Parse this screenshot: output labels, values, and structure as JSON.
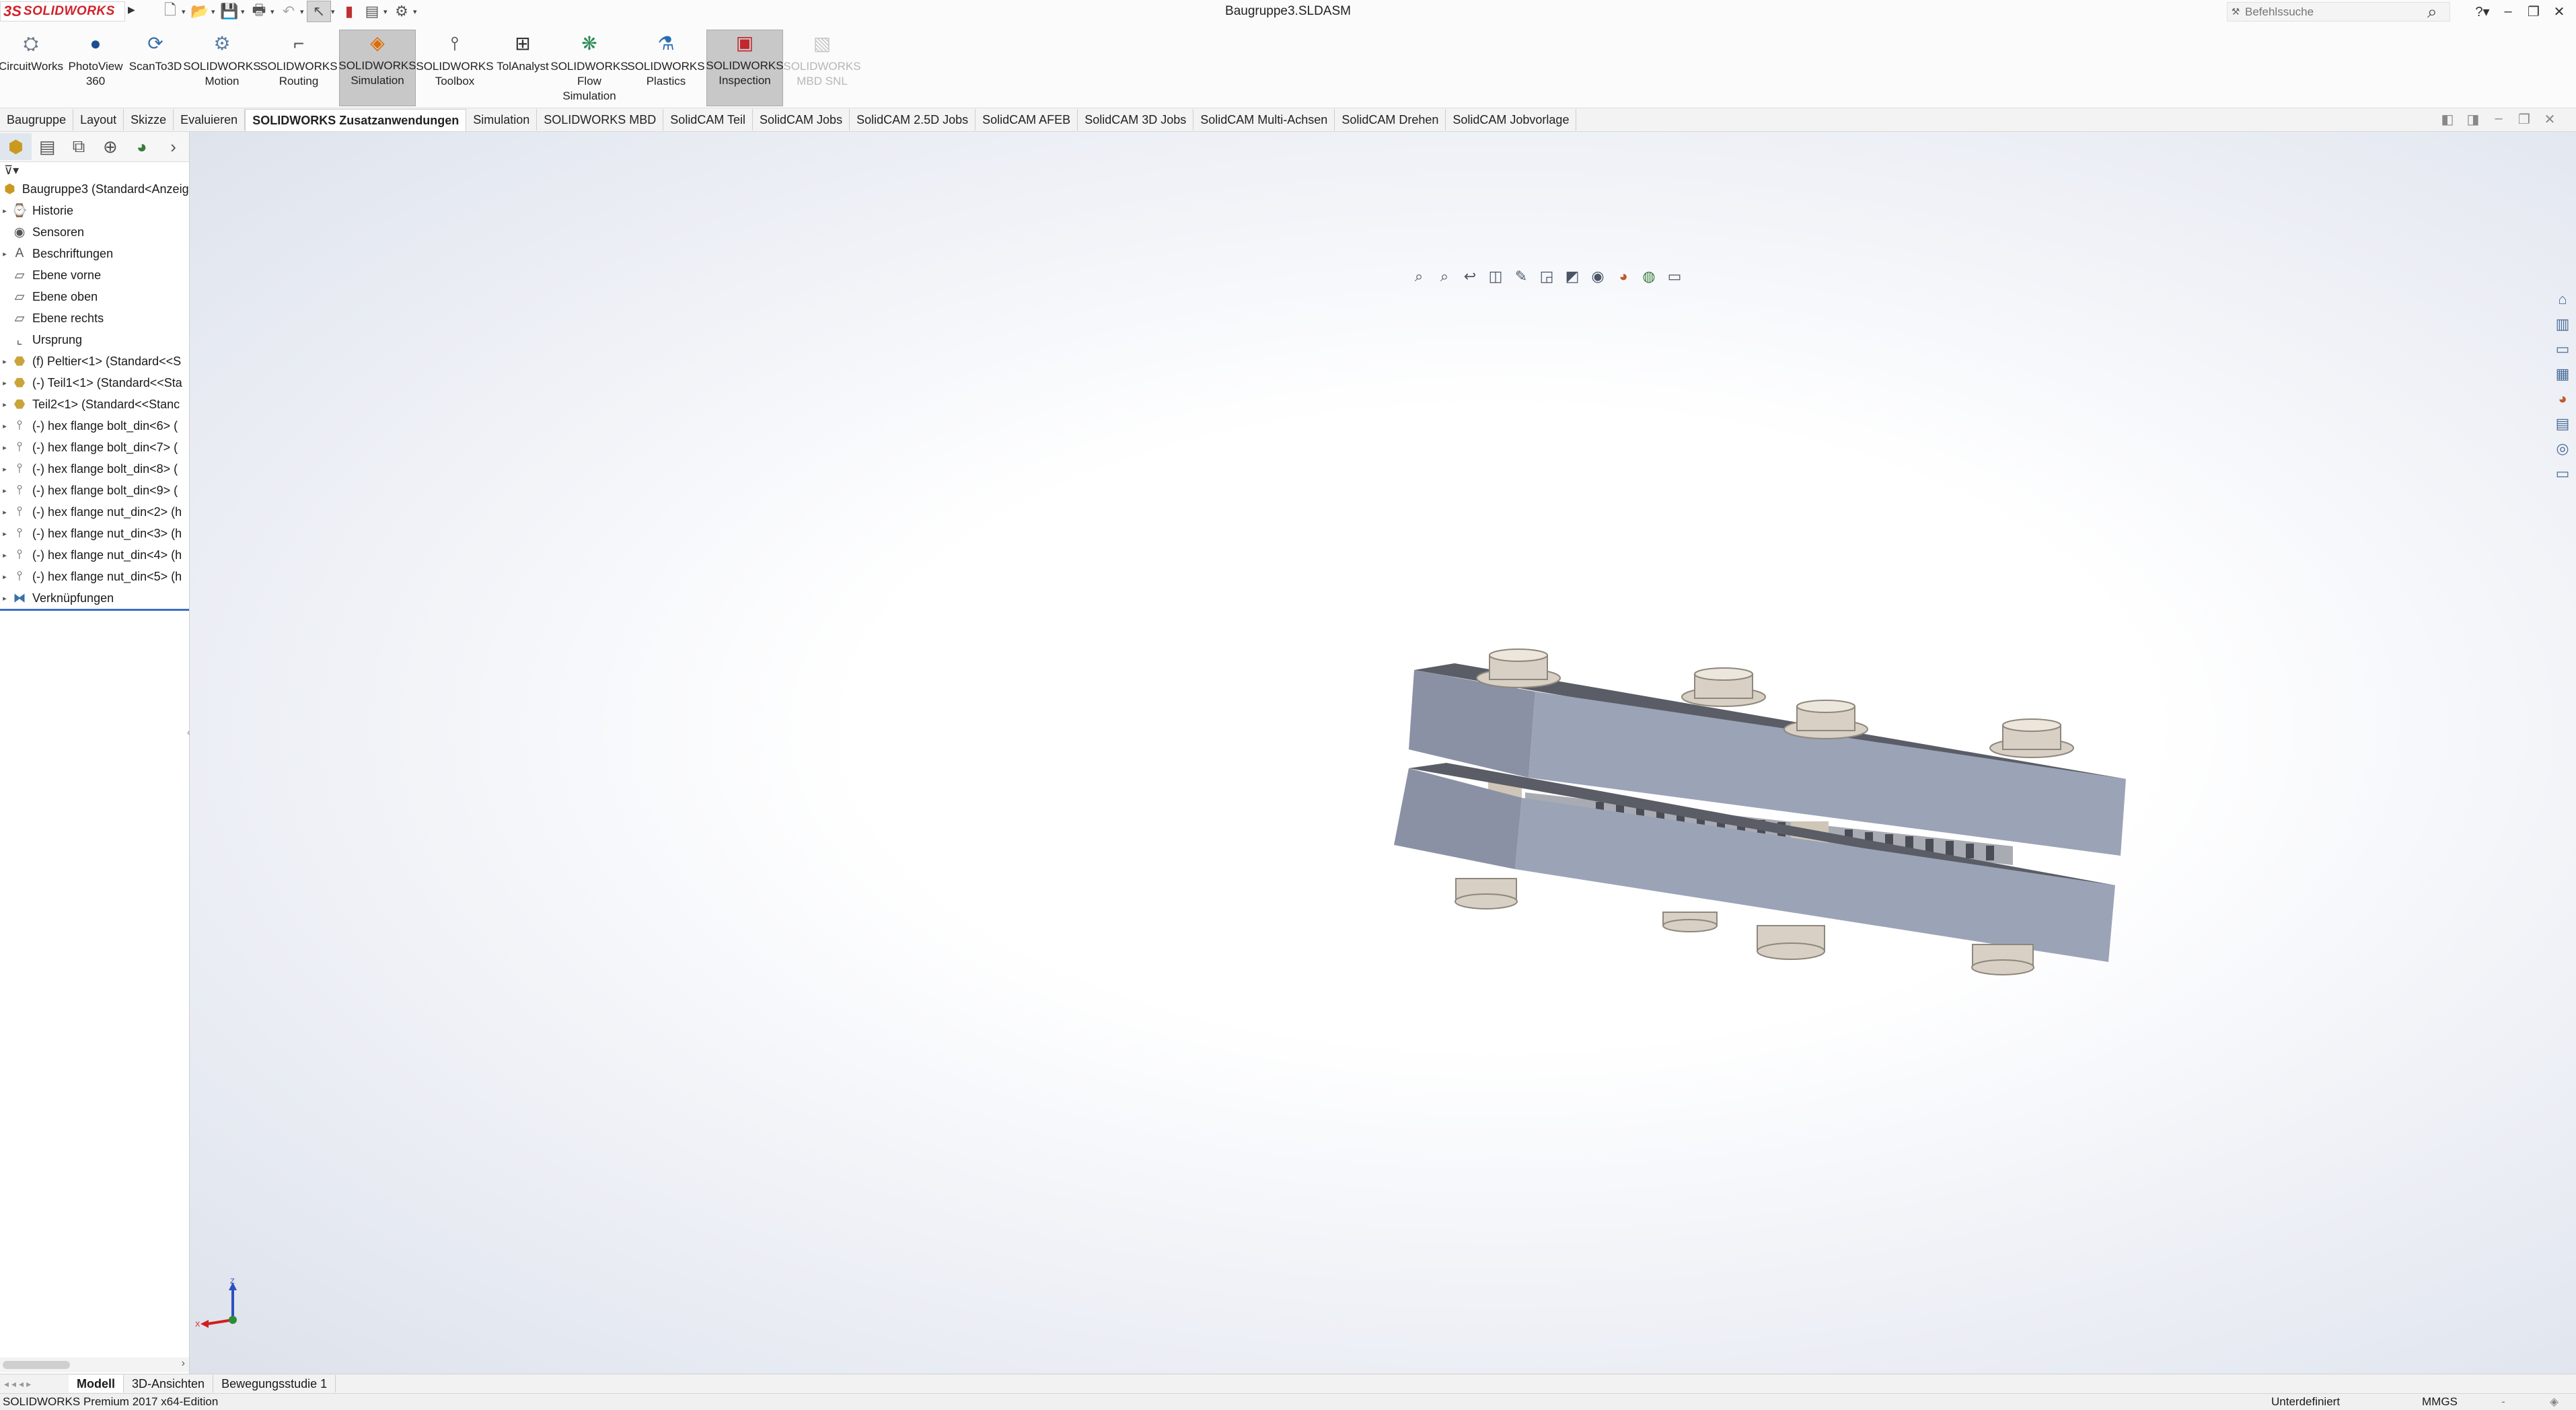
{
  "app": {
    "logo_ds": "3S",
    "logo_text": "SOLIDWORKS",
    "document_title": "Baugruppe3.SLDASM",
    "search_placeholder": "Befehlssuche"
  },
  "command_manager": [
    {
      "line1": "CircuitWorks",
      "line2": "",
      "line3": "",
      "icon": "circuitworks-icon",
      "state": "normal"
    },
    {
      "line1": "PhotoView",
      "line2": "360",
      "line3": "",
      "icon": "photoview-icon",
      "state": "normal"
    },
    {
      "line1": "ScanTo3D",
      "line2": "",
      "line3": "",
      "icon": "scanto3d-icon",
      "state": "normal"
    },
    {
      "line1": "SOLIDWORKS",
      "line2": "Motion",
      "line3": "",
      "icon": "motion-icon",
      "state": "normal"
    },
    {
      "line1": "SOLIDWORKS",
      "line2": "Routing",
      "line3": "",
      "icon": "routing-icon",
      "state": "normal"
    },
    {
      "line1": "SOLIDWORKS",
      "line2": "Simulation",
      "line3": "",
      "icon": "simulation-icon",
      "state": "active"
    },
    {
      "line1": "SOLIDWORKS",
      "line2": "Toolbox",
      "line3": "",
      "icon": "toolbox-icon",
      "state": "normal"
    },
    {
      "line1": "TolAnalyst",
      "line2": "",
      "line3": "",
      "icon": "tolanalyst-icon",
      "state": "normal"
    },
    {
      "line1": "SOLIDWORKS",
      "line2": "Flow",
      "line3": "Simulation",
      "icon": "flow-simulation-icon",
      "state": "normal"
    },
    {
      "line1": "SOLIDWORKS",
      "line2": "Plastics",
      "line3": "",
      "icon": "plastics-icon",
      "state": "normal"
    },
    {
      "line1": "SOLIDWORKS",
      "line2": "Inspection",
      "line3": "",
      "icon": "inspection-icon",
      "state": "active"
    },
    {
      "line1": "SOLIDWORKS",
      "line2": "MBD SNL",
      "line3": "",
      "icon": "mbd-snl-icon",
      "state": "disabled"
    }
  ],
  "tabs": [
    "Baugruppe",
    "Layout",
    "Skizze",
    "Evaluieren",
    "SOLIDWORKS Zusatzanwendungen",
    "Simulation",
    "SOLIDWORKS MBD",
    "SolidCAM Teil",
    "SolidCAM Jobs",
    "SolidCAM 2.5D Jobs",
    "SolidCAM AFEB",
    "SolidCAM 3D Jobs",
    "SolidCAM Multi-Achsen",
    "SolidCAM Drehen",
    "SolidCAM Jobvorlage"
  ],
  "active_tab": "SOLIDWORKS Zusatzanwendungen",
  "tree": {
    "root": "Baugruppe3  (Standard<Anzeige",
    "items": [
      {
        "label": "Historie",
        "icon": "history-folder-icon",
        "expandable": true
      },
      {
        "label": "Sensoren",
        "icon": "sensor-folder-icon",
        "expandable": false
      },
      {
        "label": "Beschriftungen",
        "icon": "annotations-folder-icon",
        "expandable": true
      },
      {
        "label": "Ebene vorne",
        "icon": "plane-icon",
        "expandable": false
      },
      {
        "label": "Ebene oben",
        "icon": "plane-icon",
        "expandable": false
      },
      {
        "label": "Ebene rechts",
        "icon": "plane-icon",
        "expandable": false
      },
      {
        "label": "Ursprung",
        "icon": "origin-icon",
        "expandable": false
      },
      {
        "label": "(f) Peltier<1> (Standard<<S",
        "icon": "part-icon",
        "expandable": true
      },
      {
        "label": "(-) Teil1<1> (Standard<<Sta",
        "icon": "part-icon",
        "expandable": true
      },
      {
        "label": "Teil2<1> (Standard<<Stanc",
        "icon": "part-icon",
        "expandable": true
      },
      {
        "label": "(-) hex flange bolt_din<6> (",
        "icon": "bolt-icon",
        "expandable": true
      },
      {
        "label": "(-) hex flange bolt_din<7> (",
        "icon": "bolt-icon",
        "expandable": true
      },
      {
        "label": "(-) hex flange bolt_din<8> (",
        "icon": "bolt-icon",
        "expandable": true
      },
      {
        "label": "(-) hex flange bolt_din<9> (",
        "icon": "bolt-icon",
        "expandable": true
      },
      {
        "label": "(-) hex flange nut_din<2> (h",
        "icon": "nut-icon",
        "expandable": true
      },
      {
        "label": "(-) hex flange nut_din<3> (h",
        "icon": "nut-icon",
        "expandable": true
      },
      {
        "label": "(-) hex flange nut_din<4> (h",
        "icon": "nut-icon",
        "expandable": true
      },
      {
        "label": "(-) hex flange nut_din<5> (h",
        "icon": "nut-icon",
        "expandable": true
      },
      {
        "label": "Verknüpfungen",
        "icon": "mates-icon",
        "expandable": true
      }
    ]
  },
  "triad": {
    "z": "Z",
    "x": "X"
  },
  "bottom_tabs": [
    "Modell",
    "3D-Ansichten",
    "Bewegungsstudie 1"
  ],
  "active_bottom_tab": "Modell",
  "status": {
    "left": "SOLIDWORKS Premium 2017 x64-Edition",
    "definition": "Unterdefiniert",
    "units": "MMGS",
    "units_arrow": "-"
  },
  "colors": {
    "brand_red": "#d2232a",
    "plate_front": "#9ba3b7",
    "plate_top": "#575a63",
    "bolt": "#d8d0c4",
    "selection_blue": "#3b6fc4"
  }
}
